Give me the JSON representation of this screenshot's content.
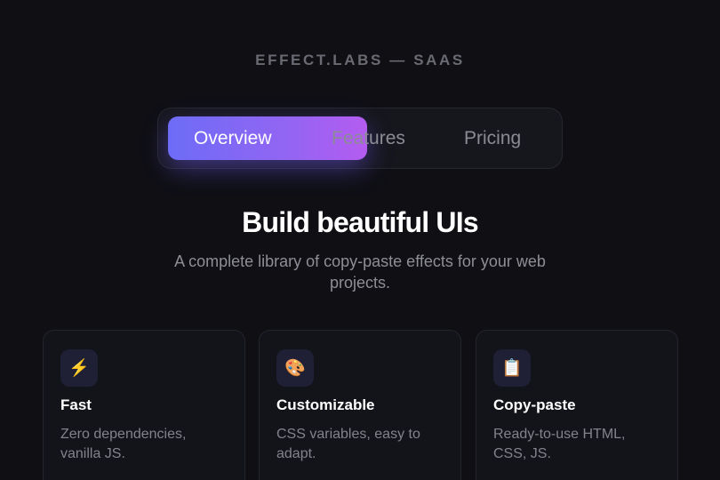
{
  "brand": "EFFECT.LABS — SAAS",
  "tabs": [
    {
      "label": "Overview",
      "active": true
    },
    {
      "label": "Features",
      "active": false
    },
    {
      "label": "Pricing",
      "active": false
    }
  ],
  "hero": {
    "title": "Build beautiful UIs",
    "subtitle": "A complete library of copy-paste effects for your web projects."
  },
  "cards": [
    {
      "icon": "⚡",
      "icon_name": "lightning-icon",
      "title": "Fast",
      "desc": "Zero dependencies, vanilla JS."
    },
    {
      "icon": "🎨",
      "icon_name": "palette-icon",
      "title": "Customizable",
      "desc": "CSS variables, easy to adapt."
    },
    {
      "icon": "📋",
      "icon_name": "clipboard-icon",
      "title": "Copy-paste",
      "desc": "Ready-to-use HTML, CSS, JS."
    }
  ],
  "colors": {
    "background": "#0f0f14",
    "accent_start": "#6d6cf7",
    "accent_end": "#b45cf0"
  }
}
